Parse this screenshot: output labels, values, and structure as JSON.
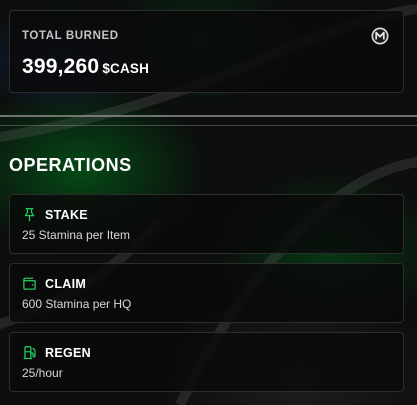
{
  "burned": {
    "label": "TOTAL BURNED",
    "value": "399,260",
    "unit": "$CASH",
    "coin_icon": "m-coin-icon"
  },
  "operations": {
    "title": "OPERATIONS",
    "items": [
      {
        "icon": "pin-icon",
        "title": "STAKE",
        "description": "25 Stamina per Item"
      },
      {
        "icon": "wallet-icon",
        "title": "CLAIM",
        "description": "600 Stamina per HQ"
      },
      {
        "icon": "fuel-icon",
        "title": "REGEN",
        "description": "25/hour"
      }
    ]
  },
  "colors": {
    "accent": "#22c55e",
    "card_bg": "#0a0a0a",
    "card_border": "#2a2d2b",
    "label_gray": "#c4c4c4"
  }
}
